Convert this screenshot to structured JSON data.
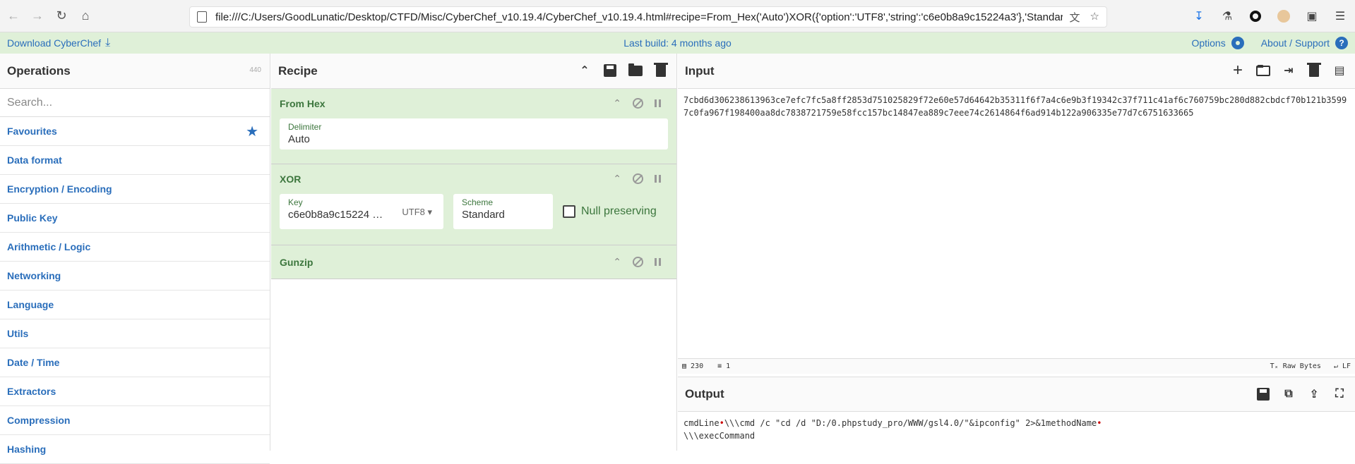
{
  "browser": {
    "url": "file:///C:/Users/GoodLunatic/Desktop/CTFD/Misc/CyberChef_v10.19.4/CyberChef_v10.19.4.html#recipe=From_Hex('Auto')XOR({'option':'UTF8','string':'c6e0b8a9c15224a3'},'Standard',fa"
  },
  "banner": {
    "download_label": "Download CyberChef",
    "build_info": "Last build: 4 months ago",
    "options_label": "Options",
    "about_label": "About / Support"
  },
  "operations": {
    "title": "Operations",
    "count": "440",
    "search_placeholder": "Search...",
    "categories": [
      "Favourites",
      "Data format",
      "Encryption / Encoding",
      "Public Key",
      "Arithmetic / Logic",
      "Networking",
      "Language",
      "Utils",
      "Date / Time",
      "Extractors",
      "Compression",
      "Hashing"
    ]
  },
  "recipe": {
    "title": "Recipe",
    "ops": [
      {
        "name": "From Hex",
        "arg_label": "Delimiter",
        "arg_value": "Auto"
      },
      {
        "name": "XOR",
        "key_label": "Key",
        "key_value": "c6e0b8a9c15224 …",
        "key_encoding": "UTF8",
        "scheme_label": "Scheme",
        "scheme_value": "Standard",
        "null_label": "Null preserving"
      },
      {
        "name": "Gunzip"
      }
    ]
  },
  "input": {
    "title": "Input",
    "text": "7cbd6d306238613963ce7efc7fc5a8ff2853d751025829f72e60e57d64642b35311f6f7a4c6e9b3f19342c37f711c41af6c760759bc280d882cbdcf70b121b35997c0fa967f198400aa8dc7838721759e58fcc157bc14847ea889c7eee74c2614864f6ad914b122a906335e77d7c6751633665",
    "status_chars": "230",
    "status_lines": "1",
    "raw_bytes": "Raw Bytes",
    "eol": "LF"
  },
  "output": {
    "title": "Output",
    "line1_a": "cmdLine",
    "line1_b": "\\\\\\cmd /c \"cd /d \"D:/0.phpstudy_pro/WWW/gsl4.0/\"&ipconfig\" 2>&1methodName",
    "line2": "\\\\\\execCommand"
  }
}
